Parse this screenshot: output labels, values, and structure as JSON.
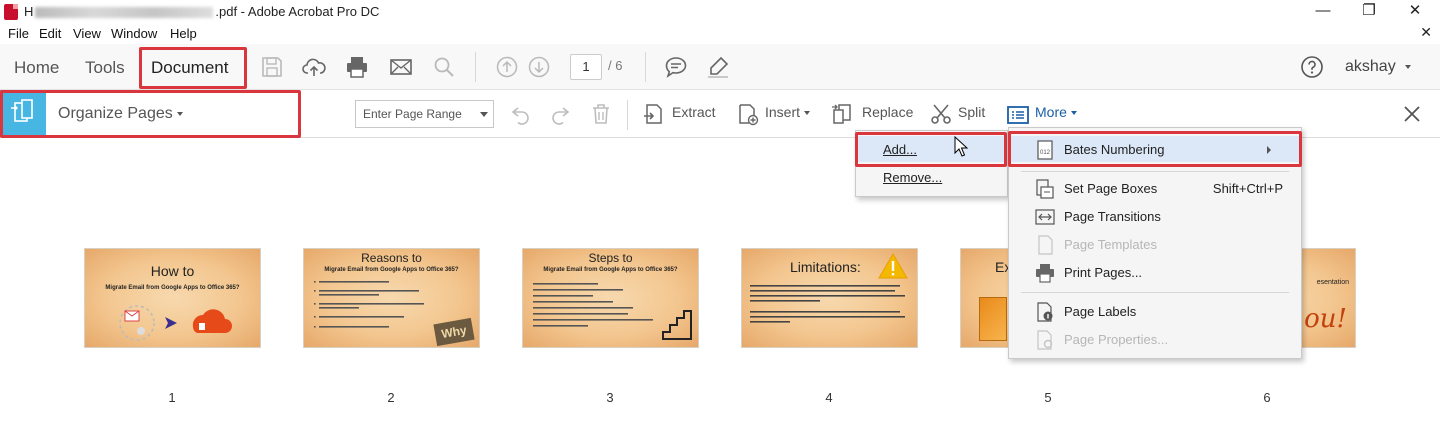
{
  "window": {
    "title_prefix": "H",
    "title_suffix": ".pdf - Adobe Acrobat Pro DC",
    "minimize_label": "—",
    "maximize_label": "❐",
    "close_label": "✕",
    "doc_close_label": "✕"
  },
  "menubar": {
    "items": [
      "File",
      "Edit",
      "View",
      "Window",
      "Help"
    ]
  },
  "toolbar": {
    "tabs": [
      "Home",
      "Tools",
      "Document"
    ],
    "active_tab": "Document",
    "current_page": "1",
    "total_pages": "/ 6",
    "user": "akshay"
  },
  "organize": {
    "title": "Organize Pages",
    "page_range_placeholder": "Enter Page Range",
    "extract_label": "Extract",
    "insert_label": "Insert",
    "replace_label": "Replace",
    "split_label": "Split",
    "more_label": "More"
  },
  "bates_submenu": {
    "add_label": "Add...",
    "remove_label": "Remove..."
  },
  "more_menu": {
    "bates_label": "Bates Numbering",
    "set_page_boxes_label": "Set Page Boxes",
    "set_page_boxes_shortcut": "Shift+Ctrl+P",
    "page_transitions_label": "Page Transitions",
    "page_templates_label": "Page Templates",
    "print_pages_label": "Print Pages...",
    "page_labels_label": "Page Labels",
    "page_properties_label": "Page Properties..."
  },
  "thumbnails": [
    {
      "number": "1",
      "title": "How to",
      "subtitle": "Migrate Email from Google Apps to Office 365?"
    },
    {
      "number": "2",
      "title": "Reasons to",
      "subtitle": "Migrate Email from Google Apps to Office 365?"
    },
    {
      "number": "3",
      "title": "Steps to",
      "subtitle": "Migrate Email from Google Apps to Office 365?"
    },
    {
      "number": "4",
      "title": "Limitations:"
    },
    {
      "number": "5",
      "title": "Ex"
    },
    {
      "number": "6",
      "title": "esentation"
    }
  ],
  "colors": {
    "highlight_red": "#d9363e",
    "organize_accent": "#47b6e3",
    "more_blue": "#1a5fa8",
    "thumb_bg": "#f3c68f"
  }
}
